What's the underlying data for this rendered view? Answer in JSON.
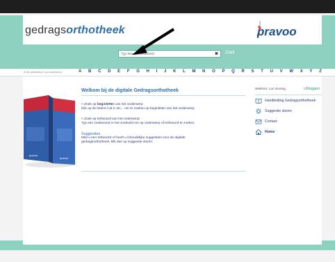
{
  "header": {
    "logo_plain": "gedrags",
    "logo_accent": "orthotheek",
    "partner_logo": "pravoo"
  },
  "search": {
    "placeholder": "Typ hier uw trefwoord",
    "clear_glyph": "✖",
    "submit_label": "Zoek"
  },
  "alphabet": {
    "hint": "Zoek alfabetisch op onderwerp:",
    "letters": [
      "A",
      "B",
      "C",
      "D",
      "E",
      "F",
      "G",
      "H",
      "I",
      "J",
      "K",
      "L",
      "M",
      "N",
      "O",
      "P",
      "Q",
      "R",
      "S",
      "T",
      "U",
      "V",
      "W",
      "X",
      "Y",
      "Z"
    ]
  },
  "main": {
    "title": "Welkom bij de digitale Gedragsorthotheek",
    "p1_line1_pre": "> Zoek op ",
    "p1_line1_bold": "beginletter",
    "p1_line1_post": " van het onderwerp",
    "p1_line2": "Klik op de letters A,B,C etc... om te zoeken op beginletter van het onderwerp.",
    "p2_line1": "> Zoek op trefwoord van het onderwerp",
    "p2_line2": "Typ een zoekwoord in het zoekveld om op onderwerp of trefwoord te zoeken.",
    "p3_title": "Suggesties",
    "p3_line1": "Mist u een trefwoord of heeft u inhoudelijke suggesties voor de digitale",
    "p3_line2": "gedragsorthotheek, klik dan op suggestie sturen."
  },
  "sidebar": {
    "user": "Welkom, Luc Koning",
    "logout": "Uitloggen",
    "items": [
      {
        "label": "Handleiding Gedragsorthotheek",
        "icon": "book-icon"
      },
      {
        "label": "Suggestie sturen",
        "icon": "gear-icon"
      },
      {
        "label": "Contact",
        "icon": "envelope-icon"
      },
      {
        "label": "Home",
        "icon": "home-icon"
      }
    ]
  },
  "colors": {
    "teal": "#8fd1bf",
    "brand_blue": "#2f6fa8",
    "text_navy": "#2a3b7a"
  }
}
